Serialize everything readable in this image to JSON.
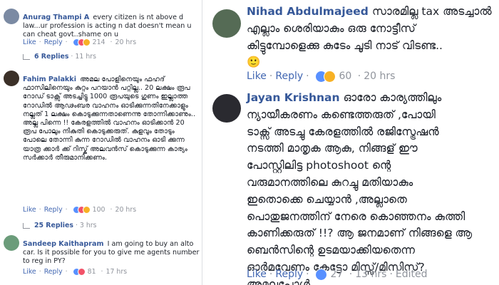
{
  "left": {
    "comments": [
      {
        "author": "Anurag Thampi A",
        "text_line1": "every citizen is nt above d",
        "text_rest": "law...ur profession is acting n dat doesn't mean u can cheat govt..shame on u",
        "like": "Like",
        "reply": "Reply",
        "reaction_count": "214",
        "time": "20 hrs",
        "replies": "6 Replies",
        "replies_time": "11 hrs",
        "avatar_color": "#7b8aa3"
      },
      {
        "author": "Fahim Palakki",
        "text_line1": "അമല പോളിനെയും ഫഹദ്",
        "text_rest": "ഫാസിലിനെയും കുറ്റം പറയാൻ പറ്റില്ല.. 20 ലക്ഷം രൂപ റോഡ് ടാക്സ് അടച്ചിട്ടു 1000 രൂപയുടെ ഗുണം ഇല്ലാത്ത റോഡിൽ ആഢംബര വാഹനം ഓടിക്കുന്നതിനേക്കാളും നല്ലത് 1 ലക്ഷം കൊടുക്കുന്നതാണെന്നു തോന്നിക്കാണും.. അല്ല പിന്നെ !! കേരളത്തിൽ വാഹനം ഓടിക്കാൻ 20 രൂപ പോലും നികുതി കൊടുക്കരുത്. കുളവും തോടും പോലെ തോന്നി കുന്ന റോഡിൽ വാഹനം ഓടി ക്കുന്ന യാത്ര ക്കാർ ക്ക് റിസ്ക് അലവൻസ് കൊടുക്കുന്ന കാര്യം സർക്കാർ തീരുമാനിക്കണം.",
        "like": "Like",
        "reply": "Reply",
        "reaction_count": "100",
        "time": "20 hrs",
        "replies": "25 Replies",
        "replies_time": "3 hrs",
        "avatar_color": "#3b3028"
      },
      {
        "author": "Sandeep Kaithapram",
        "text_line1": "I am going to buy an alto",
        "text_rest": "car. Is it possible for you to give me agents number to reg in PY?",
        "like": "Like",
        "reply": "Reply",
        "reaction_count": "81",
        "time": "17 hrs",
        "avatar_color": "#6b9c7a"
      }
    ]
  },
  "right": {
    "comments": [
      {
        "author": "Nihad Abdulmajeed",
        "text_line1": "സാരമില്ല tax അടച്ചാൽ",
        "lines": [
          "എല്ലാം ശെരിയാകും ഒരു നോട്ടീസ്",
          "കിട്ടുമ്പോളെക്കു കുടേം ചൂടി നാട് വിടണ്ട..",
          "🙂"
        ],
        "like": "Like",
        "reply": "Reply",
        "reaction_count": "60",
        "time": "20 hrs",
        "avatar_color": "#556b55"
      },
      {
        "author": "Jayan Krishnan",
        "text_line1": "ഓരോ കാര്യത്തിലും",
        "lines": [
          "ന്യായീകരണം കണ്ടെത്തരുത് ,പോയി",
          "ടാക്സ് അടച്ചു കേരളത്തിൽ രജിസ്ട്രേഷൻ",
          "നടത്തി മാതൃക ആകു, നിങ്ങള് ഈ",
          "പോസ്റ്റിലിട്ട photoshoot ന്റെ",
          "വരുമാനത്തിലെ കുറച്ചു മതിയാകും",
          "ഇതൊക്കെ ചെയ്യാൻ ,അല്ലാതെ",
          "പൊതുജനത്തിന് നേരെ കൊഞ്ഞനം കുത്തി",
          "കാണിക്കരുത് !!? ആ ജനമാണ് നിങ്ങളെ ആ",
          "ബെൻസിന്റെ ഉടമയാക്കിയതെന്ന",
          "ഓർമവേണം കേട്ടോ മിസ്സ്/മിസിസ്?",
          "അമലപോൾ"
        ],
        "like": "Like",
        "reply": "Reply",
        "reaction_count": "27",
        "time": "13 hrs",
        "edited": "Edited",
        "avatar_color": "#2a2a30"
      }
    ]
  },
  "colors": {
    "name": "#365899",
    "link": "#4267b2",
    "meta": "#90949c",
    "like_reaction": "#5890ff",
    "love_reaction": "#f25268",
    "haha_reaction": "#f7b125"
  }
}
